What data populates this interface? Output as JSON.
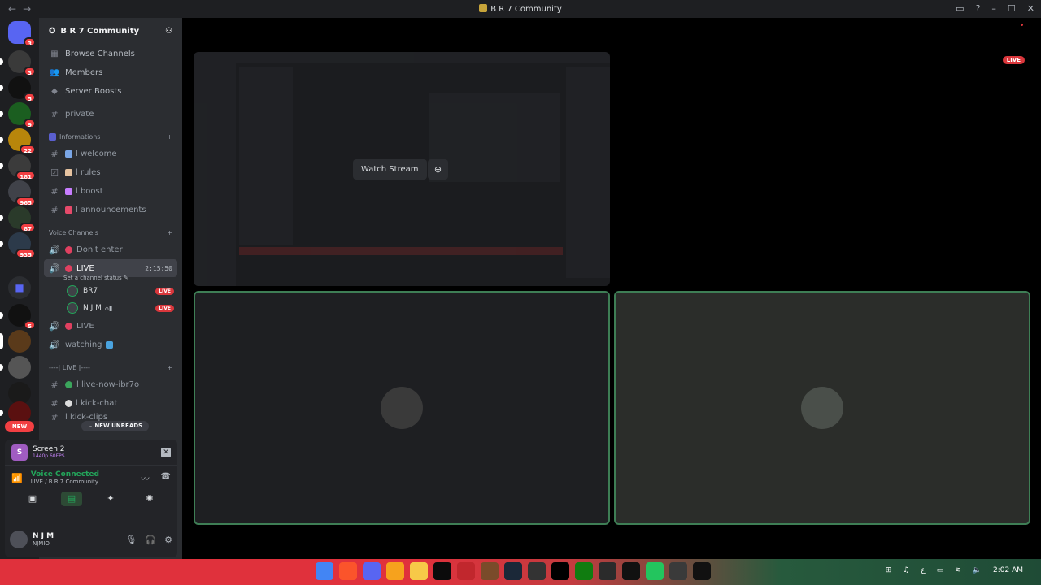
{
  "window": {
    "title": "B R 7 Community",
    "back": "←",
    "forward": "→",
    "controls": [
      "▭",
      "?",
      "–",
      "☐",
      "✕"
    ]
  },
  "guilds": {
    "badges": [
      "3",
      "3",
      "5",
      "9",
      "22",
      "181",
      "965",
      "87",
      "935",
      "5"
    ],
    "new_label": "NEW"
  },
  "sidebar": {
    "server_name": "B R 7 Community",
    "nav": [
      {
        "label": "Browse Channels",
        "icon": "▦"
      },
      {
        "label": "Members",
        "icon": "👥"
      },
      {
        "label": "Server Boosts",
        "icon": "◆"
      }
    ],
    "private_channel": "private",
    "categories": {
      "info": "Informations",
      "voice": "Voice Channels",
      "live": "----| LIVE |----"
    },
    "info_channels": [
      "l welcome",
      "l rules",
      "l boost",
      "l announcements"
    ],
    "voice_channels": {
      "dont_enter": "Don't enter",
      "live": "LIVE",
      "live_time": "2:15:50",
      "status": "Set a channel status",
      "users": [
        {
          "name": "BR7",
          "badge": "LIVE"
        },
        {
          "name": "N J M",
          "badge": "LIVE"
        }
      ],
      "live2": "LIVE",
      "watching": "watching"
    },
    "live_channels": [
      "l live-now-ibr7o",
      "l kick-chat",
      "l kick-clips"
    ],
    "new_unreads": "NEW UNREADS"
  },
  "panel": {
    "screen_title": "Screen 2",
    "screen_sub": "1440p 60FPS",
    "voice_title": "Voice Connected",
    "voice_sub": "LIVE / B R 7 Community",
    "user_name": "N J M",
    "user_tag": "NJMIO"
  },
  "stage": {
    "live_badge": "LIVE",
    "watch_label": "Watch Stream"
  },
  "taskbar": {
    "time": "2:02 AM",
    "colors": [
      "#4285f4",
      "#fb542b",
      "#5865f2",
      "#f6a21d",
      "#f7c948",
      "#0b0b0b",
      "#c1272d",
      "#7a4b2a",
      "#1b2838",
      "#333333",
      "#000000",
      "#107c10",
      "#2b2b2b",
      "#111111",
      "#23c55e",
      "#3a3a3a",
      "#111111"
    ]
  },
  "colors": {
    "accent_green": "#23a55a",
    "live_red": "#da373c",
    "blurple": "#5865f2"
  }
}
